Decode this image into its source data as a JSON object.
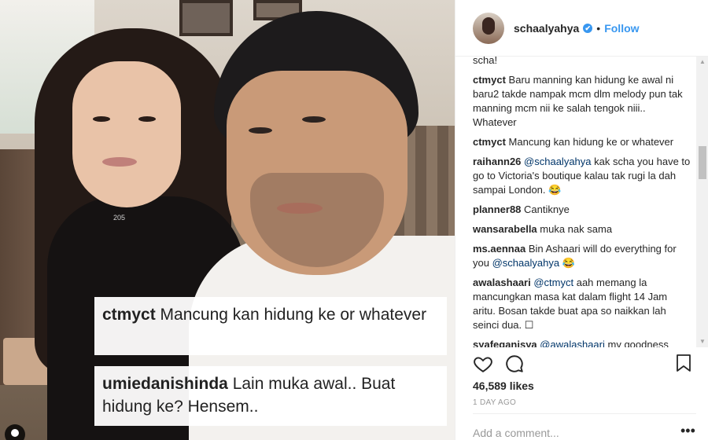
{
  "post": {
    "username": "schaalyahya",
    "verified_mark": "✔",
    "separator": "•",
    "follow_label": "Follow",
    "likes": "46,589 likes",
    "time": "1 DAY AGO",
    "add_comment_placeholder": "Add a comment...",
    "more_label": "•••"
  },
  "photo": {
    "shirt_number": "205",
    "captions": [
      {
        "user": "ctmyct",
        "text": "Mancung kan hidung ke or whatever"
      },
      {
        "user": "umiedanishinda",
        "text": "Lain muka awal.. Buat hidung ke? Hensem.."
      }
    ]
  },
  "comments": [
    {
      "user": "",
      "text": "scha!"
    },
    {
      "user": "ctmyct",
      "text": "Baru manning kan hidung ke awal ni baru2 takde nampak mcm dlm melody pun tak manning mcm nii ke salah tengok niii.. Whatever",
      "mention": ""
    },
    {
      "user": "ctmyct",
      "text": "Mancung kan hidung ke or whatever",
      "mention": ""
    },
    {
      "user": "raihann26",
      "mention": "@schaalyahya",
      "text": "kak scha you have to go to Victoria's boutique kalau tak rugi la dah sampai London. 😂"
    },
    {
      "user": "planner88",
      "text": "Cantiknye",
      "mention": ""
    },
    {
      "user": "wansarabella",
      "text": "muka nak sama",
      "mention": ""
    },
    {
      "user": "ms.aennaa",
      "text": "Bin Ashaari will do everything for you",
      "mention": "@schaalyahya",
      "emoji": "😂"
    },
    {
      "user": "awalashaari",
      "mention": "@ctmyct",
      "text": "aah memang la mancungkan masa kat dalam flight 14 Jam aritu. Bosan takde buat apa so naikkan lah seinci dua. ☐"
    },
    {
      "user": "syafeqanisya",
      "mention": "@awalashaari",
      "text": "my goodness"
    }
  ],
  "icons": {
    "heart": "heart-icon",
    "comment": "comment-icon",
    "bookmark": "bookmark-icon",
    "scroll_up": "▲",
    "scroll_down": "▼"
  }
}
